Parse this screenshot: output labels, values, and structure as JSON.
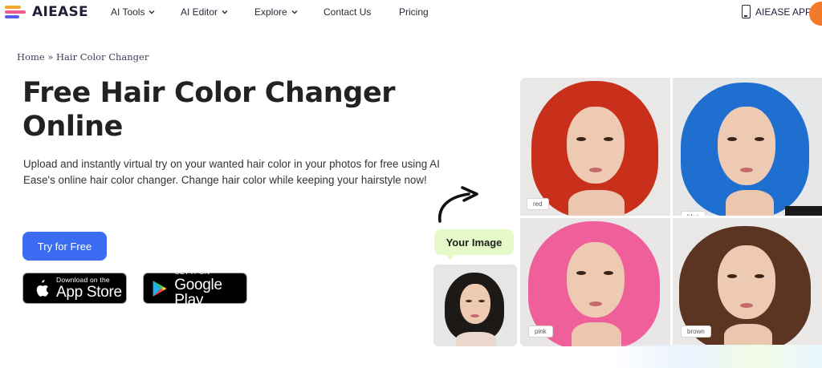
{
  "nav": {
    "logo_text": "AIEASE",
    "items": [
      {
        "label": "AI Tools",
        "has_dropdown": true
      },
      {
        "label": "AI Editor",
        "has_dropdown": true
      },
      {
        "label": "Explore",
        "has_dropdown": true
      },
      {
        "label": "Contact Us",
        "has_dropdown": false
      },
      {
        "label": "Pricing",
        "has_dropdown": false
      }
    ],
    "app_label": "AIEASE APP"
  },
  "breadcrumb": "Home » Hair Color Changer",
  "hero": {
    "title": "Free Hair Color Changer Online",
    "description": "Upload and instantly virtual try on your wanted hair color in your photos for free using AI Ease's online hair color changer. Change hair color while keeping your hairstyle now!",
    "cta_label": "Try for Free"
  },
  "stores": {
    "appstore": {
      "small": "Download on the",
      "big": "App Store"
    },
    "googleplay": {
      "small": "GET IT ON",
      "big": "Google Play"
    }
  },
  "samples": {
    "your_image_label": "Your Image",
    "tags": [
      "red",
      "blue",
      "pink",
      "brown"
    ]
  },
  "colors": {
    "accent_blue": "#3b6cf2",
    "bubble_green": "#e6f9c8",
    "hair_red": "#c9301c",
    "hair_blue": "#1f6fd0",
    "hair_pink": "#ef5f9a",
    "hair_brown": "#5b3422",
    "hair_black": "#1c1917"
  }
}
